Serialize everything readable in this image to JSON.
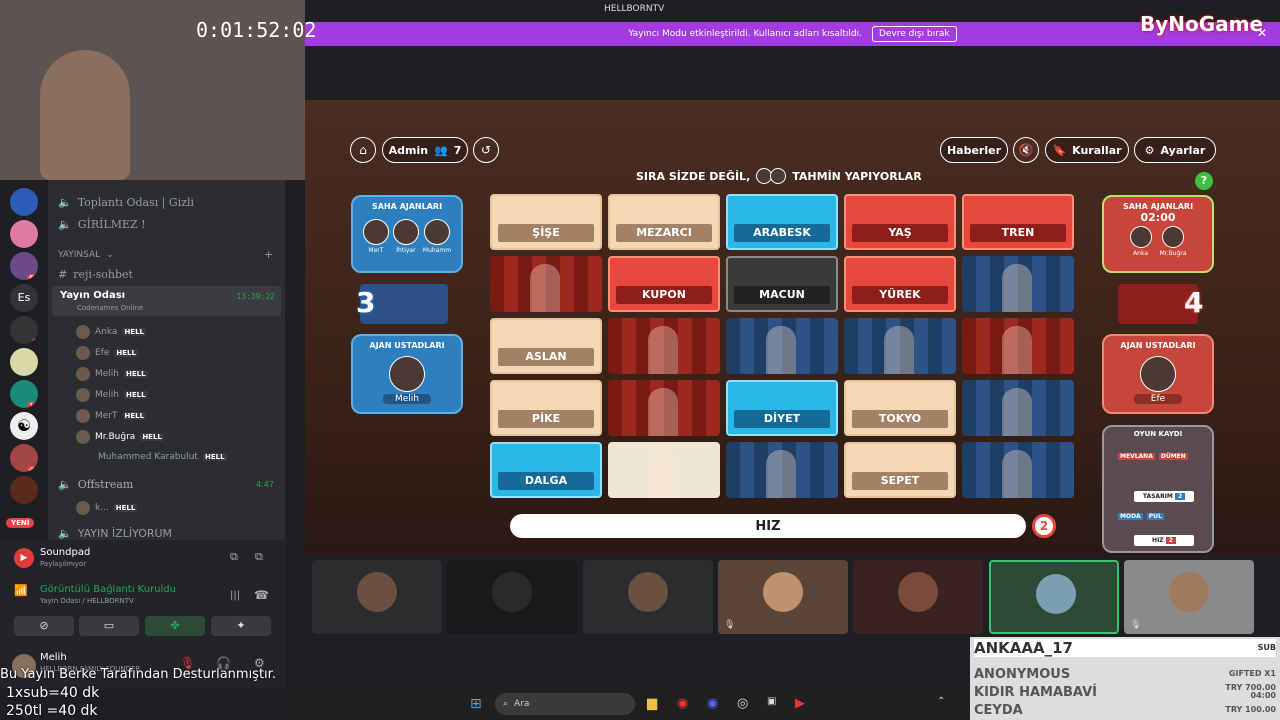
{
  "window": {
    "title": "HELLBORNTV"
  },
  "stream": {
    "timer": "0:01:52:02",
    "watermark": "ByNoGame"
  },
  "banner": {
    "text": "Yayıncı Modu etkinleştirildi. Kullanıcı adları kısaltıldı.",
    "button": "Devre dışı bırak"
  },
  "discord": {
    "channels": [
      "Toplantı Odası | Gizli",
      "GİRİLMEZ !"
    ],
    "category": "YAYINSAL",
    "text_channel": "reji-sohbet",
    "voice_channel": "Yayın Odası",
    "voice_time": "13:39:22",
    "activity": "Codenames Online",
    "users": [
      "Anka",
      "Efe",
      "Melih",
      "Melih",
      "MerT",
      "Mr.Buğra",
      "Muhammed Karabulut"
    ],
    "user_tag": "HELL",
    "offstream": "Offstream",
    "offstream_time": "4:47",
    "off_user": "k...",
    "izliyorum": "YAYIN İZLİYORUM",
    "new_badge": "YENİ",
    "es_label": "Es",
    "server_badges": [
      "66",
      "7",
      "11",
      "47"
    ],
    "soundpad_title": "Soundpad",
    "soundpad_sub": "Paylaşılmıyor",
    "conn_title": "Görüntülü Bağlantı Kuruldu",
    "conn_sub": "Yayın Odası / HELLBORNTV",
    "me": "Melih",
    "me_sub": "HELLBORN FAMILY FOUNDER"
  },
  "game": {
    "admin": "Admin",
    "players": "7",
    "news": "Haberler",
    "rules": "Kurallar",
    "settings": "Ayarlar",
    "status_left": "SIRA SİZDE DEĞİL,",
    "status_right": "TAHMİN YAPIYORLAR",
    "blue_agents_title": "SAHA AJANLARI",
    "blue_agents": [
      "MerT",
      "İhtiyar",
      "Muhamm"
    ],
    "blue_score": "3",
    "blue_masters_title": "AJAN USTADLARI",
    "blue_master": "Melih",
    "red_agents_title": "SAHA AJANLARI",
    "red_timer": "02:00",
    "red_agents": [
      "Anka",
      "Mr.Buğra"
    ],
    "red_score": "4",
    "red_masters_title": "AJAN USTADLARI",
    "red_master": "Efe",
    "log_title": "OYUN KAYDI",
    "log": [
      {
        "name": "MEVLANA",
        "tag": "DÜMEN"
      },
      {
        "name": "TASARIM",
        "n": "2"
      },
      {
        "name": "MODA",
        "tag": "PUL"
      },
      {
        "name": "HIZ",
        "n": "2"
      }
    ],
    "clue": "HIZ",
    "clue_count": "2",
    "cards": [
      {
        "w": "ŞİŞE",
        "t": "neutral"
      },
      {
        "w": "MEZARCI",
        "t": "neutral"
      },
      {
        "w": "ARABESK",
        "t": "blue"
      },
      {
        "w": "YAŞ",
        "t": "red"
      },
      {
        "w": "TREN",
        "t": "red"
      },
      {
        "w": "",
        "t": "img-red"
      },
      {
        "w": "KUPON",
        "t": "red"
      },
      {
        "w": "MACUN",
        "t": "black"
      },
      {
        "w": "YÜREK",
        "t": "red"
      },
      {
        "w": "",
        "t": "img-blue"
      },
      {
        "w": "ASLAN",
        "t": "neutral"
      },
      {
        "w": "",
        "t": "img-red"
      },
      {
        "w": "",
        "t": "img-blue"
      },
      {
        "w": "",
        "t": "img-blue"
      },
      {
        "w": "",
        "t": "img-red"
      },
      {
        "w": "PİKE",
        "t": "neutral"
      },
      {
        "w": "",
        "t": "img-red"
      },
      {
        "w": "DİYET",
        "t": "blue"
      },
      {
        "w": "TOKYO",
        "t": "neutral"
      },
      {
        "w": "",
        "t": "img-blue"
      },
      {
        "w": "DALGA",
        "t": "blue"
      },
      {
        "w": "",
        "t": "img-sketch"
      },
      {
        "w": "",
        "t": "img-blue"
      },
      {
        "w": "SEPET",
        "t": "neutral"
      },
      {
        "w": "",
        "t": "img-blue"
      }
    ]
  },
  "subs": [
    {
      "name": "ANKAAA_17",
      "right": "SUB"
    },
    {
      "name": "ANONYMOUS",
      "right": "GIFTED X1"
    },
    {
      "name": "KIDIR HAMABAVİ",
      "right": "TRY 700.00",
      "right2": "04:00"
    },
    {
      "name": "CEYDA",
      "right": "TRY 100.00"
    }
  ],
  "overlay": {
    "line1": "Bu Yayın Berke Tarafından Desturlanmıştır.",
    "line2": "1xsub=40 dk",
    "line3": "250tl =40 dk"
  },
  "taskbar": {
    "search": "Ara"
  }
}
